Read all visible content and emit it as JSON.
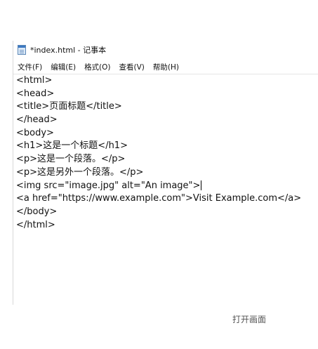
{
  "window": {
    "title": "*index.html - 记事本"
  },
  "menu": [
    {
      "label": "文件(F)"
    },
    {
      "label": "编辑(E)"
    },
    {
      "label": "格式(O)"
    },
    {
      "label": "查看(V)"
    },
    {
      "label": "帮助(H)"
    }
  ],
  "editor": {
    "lines": [
      "<html>",
      "<head>",
      "<title>页面标题</title>",
      "</head>",
      "<body>",
      "<h1>这是一个标题</h1>",
      "<p>这是一个段落。</p>",
      "<p>这是另外一个段落。</p>",
      "<img src=\"image.jpg\" alt=\"An image\">",
      "<a href=\"https://www.example.com\">Visit Example.com</a>",
      "</body>",
      "</html>"
    ]
  },
  "caption": "打开画面"
}
